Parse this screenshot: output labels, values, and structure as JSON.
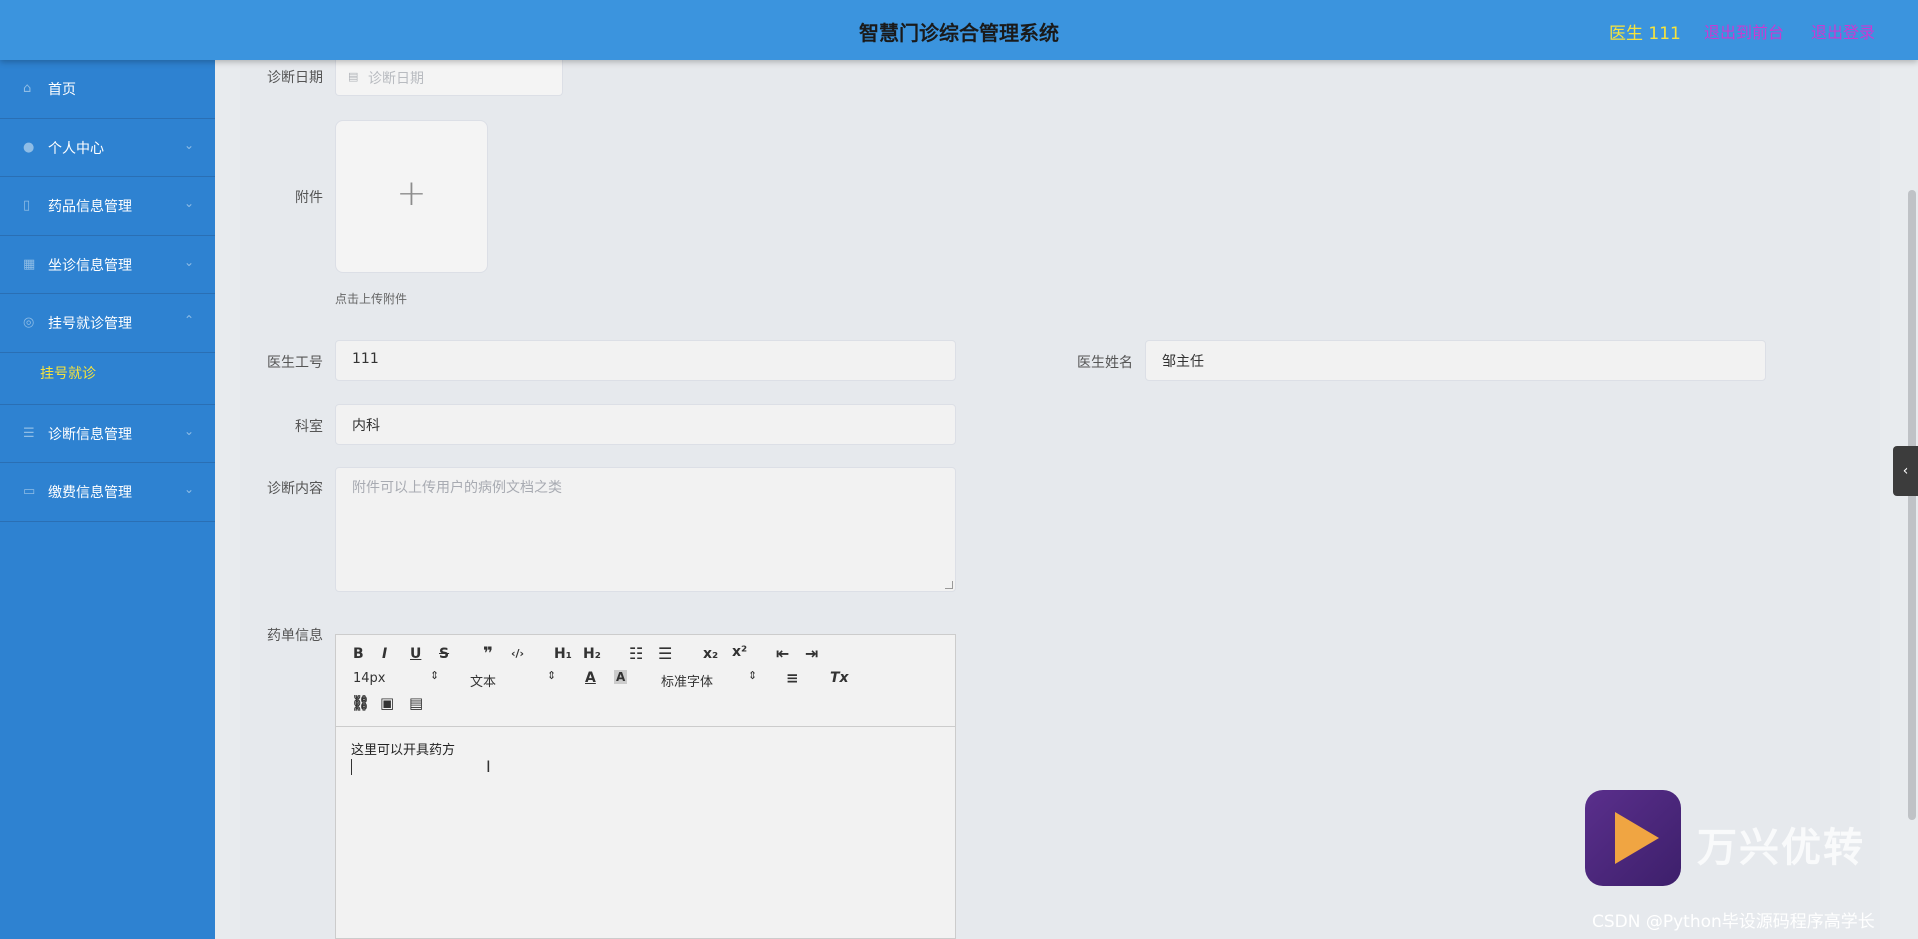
{
  "header": {
    "title": "智慧门诊综合管理系统",
    "user": "医生 111",
    "back_front": "退出到前台",
    "logout": "退出登录"
  },
  "sidebar": {
    "items": [
      {
        "label": "首页",
        "icon": "home-icon"
      },
      {
        "label": "个人中心",
        "icon": "user-icon"
      },
      {
        "label": "药品信息管理",
        "icon": "phone-icon"
      },
      {
        "label": "坐诊信息管理",
        "icon": "grid-icon"
      },
      {
        "label": "挂号就诊管理",
        "icon": "compass-icon"
      },
      {
        "label": "诊断信息管理",
        "icon": "list-icon"
      },
      {
        "label": "缴费信息管理",
        "icon": "message-icon"
      }
    ],
    "sub_item": "挂号就诊"
  },
  "form": {
    "date_label": "诊断日期",
    "date_placeholder": "诊断日期",
    "attachment_label": "附件",
    "attachment_hint": "点击上传附件",
    "doctor_id_label": "医生工号",
    "doctor_id_value": "111",
    "doctor_name_label": "医生姓名",
    "doctor_name_value": "邹主任",
    "dept_label": "科室",
    "dept_value": "内科",
    "content_label": "诊断内容",
    "content_placeholder": "附件可以上传用户的病例文档之类",
    "prescription_label": "药单信息"
  },
  "editor": {
    "font_size": "14px",
    "block_type": "文本",
    "font_family": "标准字体",
    "body_text": "这里可以开具药方",
    "buttons": [
      "B",
      "I",
      "U",
      "S",
      "❞",
      "‹/›",
      "H₁",
      "H₂",
      "x₂",
      "x²",
      "Tx"
    ]
  },
  "watermark": {
    "brand": "万兴优转",
    "credit": "CSDN @Python毕设源码程序高学长"
  },
  "colors": {
    "header_bg": "#3b94de",
    "sidebar_bg": "#2e82d1",
    "user_color": "#f6e33c",
    "link_color": "#c93ad2"
  }
}
